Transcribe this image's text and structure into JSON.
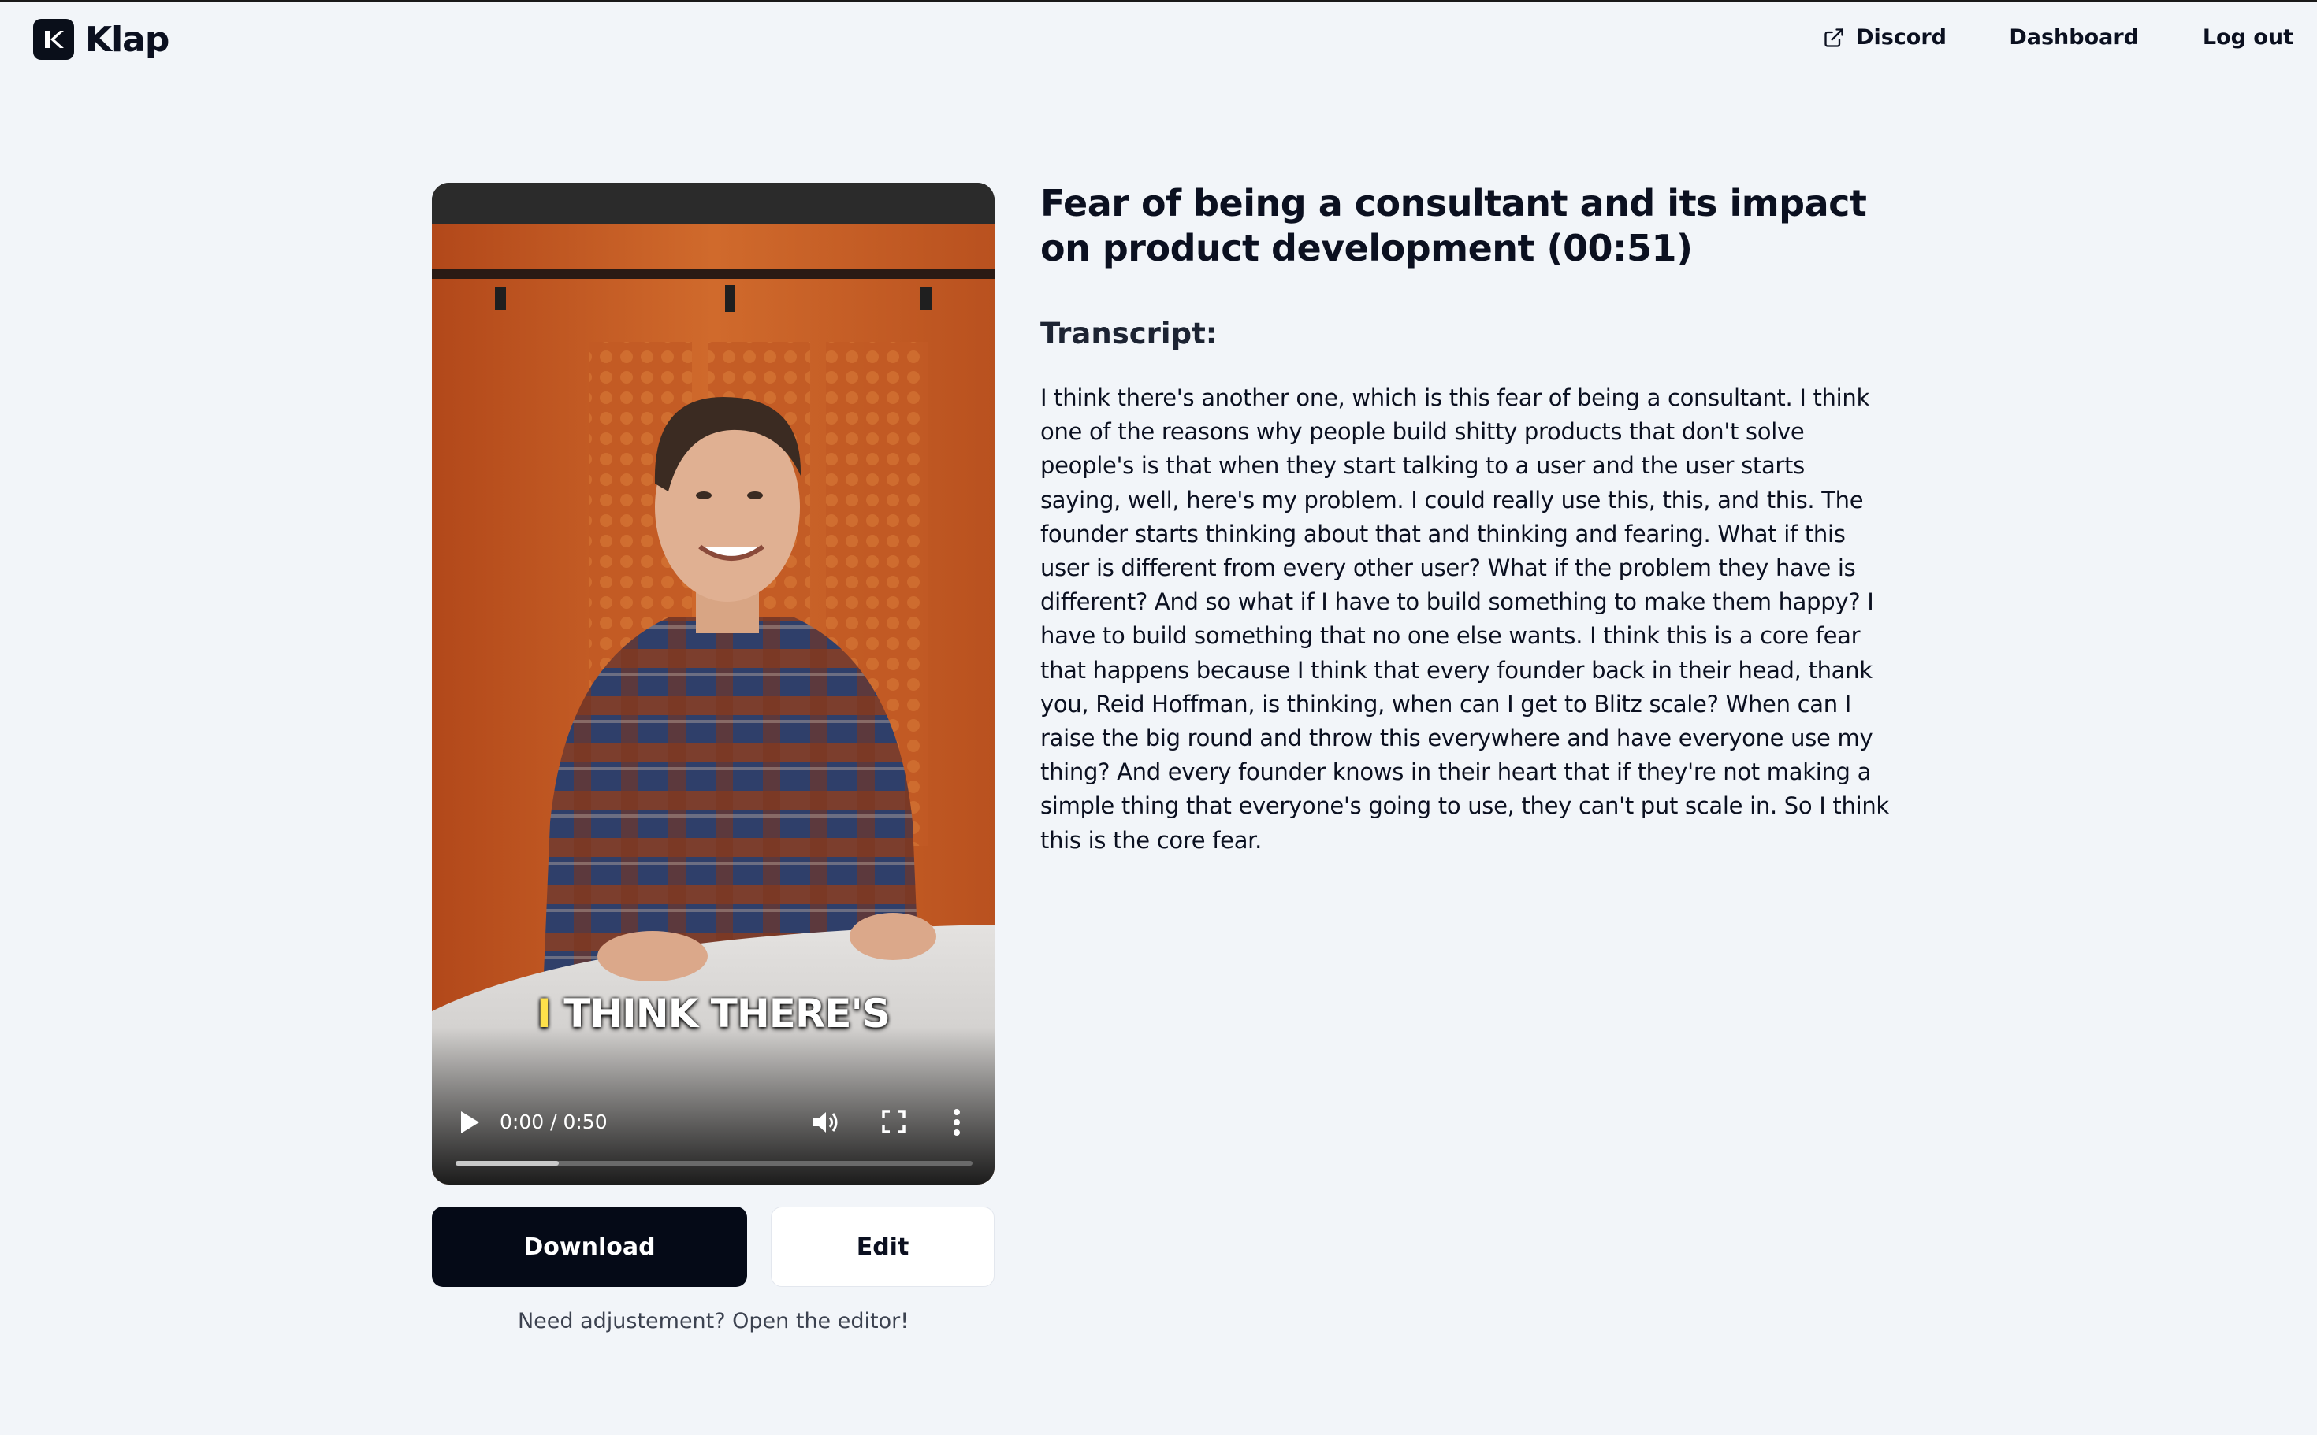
{
  "brand": {
    "name": "Klap"
  },
  "nav": {
    "discord": "Discord",
    "dashboard": "Dashboard",
    "logout": "Log out"
  },
  "video": {
    "caption_highlight": "I",
    "caption_rest": "THINK THERE'S",
    "time": "0:00 / 0:50",
    "buffered_fraction": 0.2
  },
  "actions": {
    "download": "Download",
    "edit": "Edit",
    "hint": "Need adjustement? Open the editor!"
  },
  "clip": {
    "title": "Fear of being a consultant and its impact on product development (00:51)",
    "transcript_heading": "Transcript:",
    "transcript": "I think there's another one, which is this fear of being a consultant. I think one of the reasons why people build shitty products that don't solve people's is that when they start talking to a user and the user starts saying, well, here's my problem. I could really use this, this, and this. The founder starts thinking about that and thinking and fearing. What if this user is different from every other user? What if the problem they have is different? And so what if I have to build something to make them happy? I have to build something that no one else wants. I think this is a core fear that happens because I think that every founder back in their head, thank you, Reid Hoffman, is thinking, when can I get to Blitz scale? When can I raise the big round and throw this everywhere and have everyone use my thing? And every founder knows in their heart that if they're not making a simple thing that everyone's going to use, they can't put scale in. So I think this is the core fear."
  },
  "colors": {
    "background": "#f2f5f9",
    "primary_button": "#050a17",
    "caption_highlight": "#ffe14a"
  }
}
